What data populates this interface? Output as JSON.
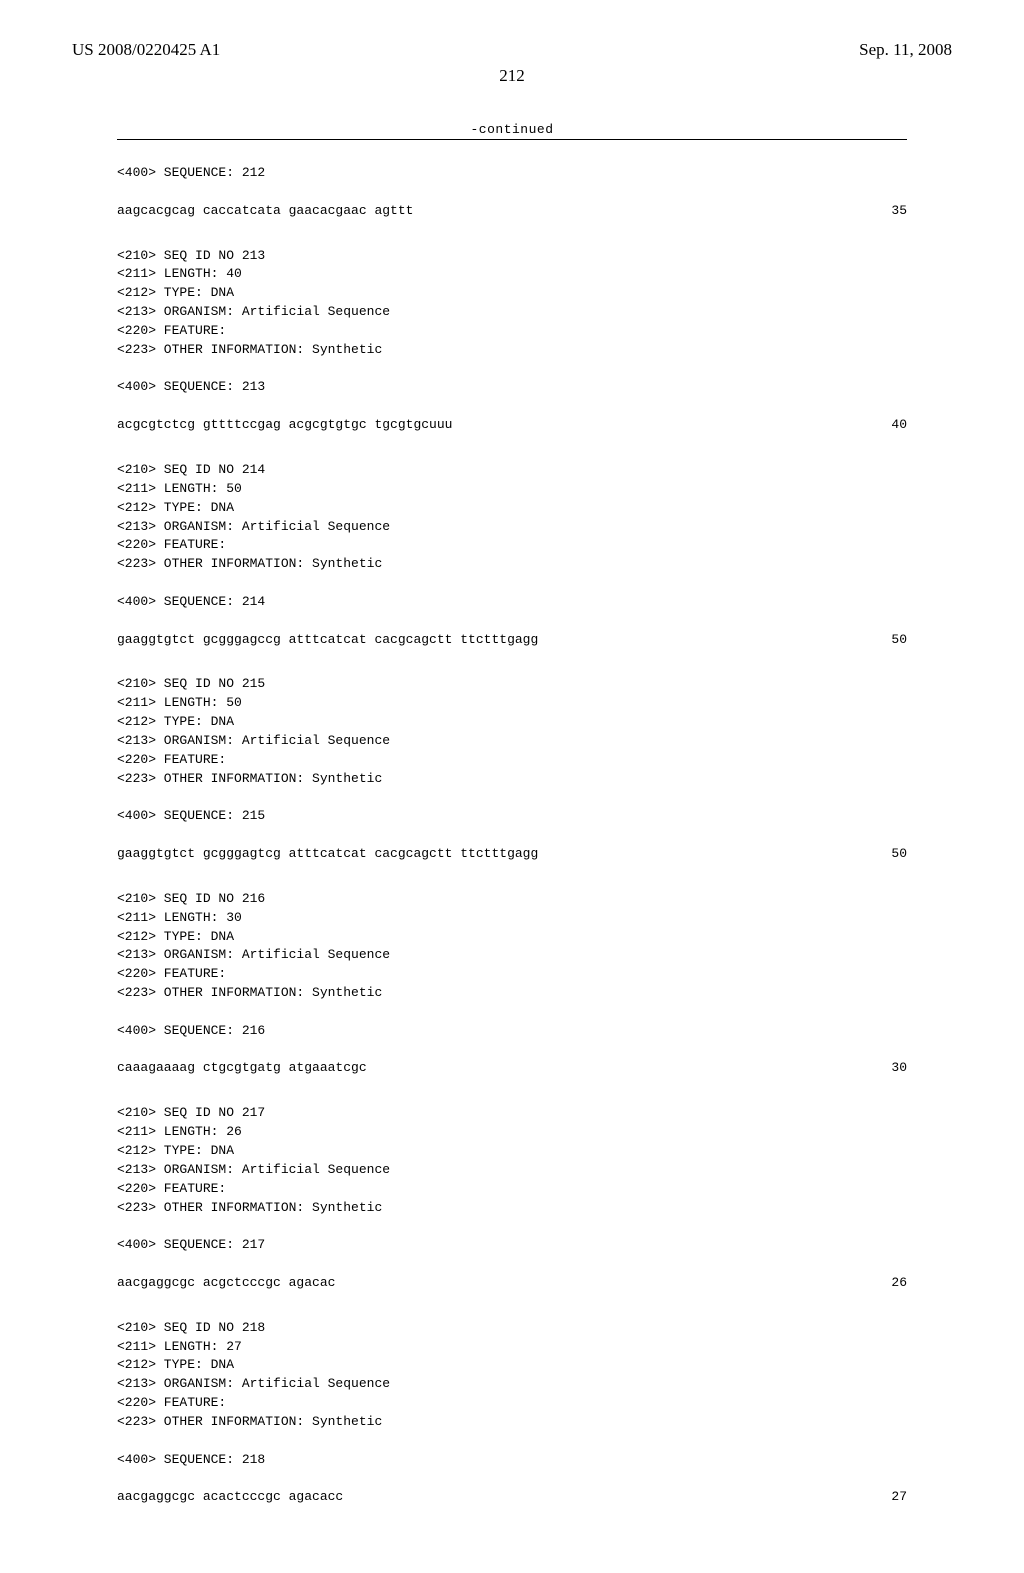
{
  "header": {
    "pub_number": "US 2008/0220425 A1",
    "pub_date": "Sep. 11, 2008"
  },
  "page_number": "212",
  "continued_label": "-continued",
  "entries": [
    {
      "descriptors": [
        "<400> SEQUENCE: 212"
      ],
      "sequence": "aagcacgcag caccatcata gaacacgaac agttt",
      "length": "35"
    },
    {
      "descriptors": [
        "<210> SEQ ID NO 213",
        "<211> LENGTH: 40",
        "<212> TYPE: DNA",
        "<213> ORGANISM: Artificial Sequence",
        "<220> FEATURE:",
        "<223> OTHER INFORMATION: Synthetic",
        "",
        "<400> SEQUENCE: 213"
      ],
      "sequence": "acgcgtctcg gttttccgag acgcgtgtgc tgcgtgcuuu",
      "length": "40"
    },
    {
      "descriptors": [
        "<210> SEQ ID NO 214",
        "<211> LENGTH: 50",
        "<212> TYPE: DNA",
        "<213> ORGANISM: Artificial Sequence",
        "<220> FEATURE:",
        "<223> OTHER INFORMATION: Synthetic",
        "",
        "<400> SEQUENCE: 214"
      ],
      "sequence": "gaaggtgtct gcgggagccg atttcatcat cacgcagctt ttctttgagg",
      "length": "50"
    },
    {
      "descriptors": [
        "<210> SEQ ID NO 215",
        "<211> LENGTH: 50",
        "<212> TYPE: DNA",
        "<213> ORGANISM: Artificial Sequence",
        "<220> FEATURE:",
        "<223> OTHER INFORMATION: Synthetic",
        "",
        "<400> SEQUENCE: 215"
      ],
      "sequence": "gaaggtgtct gcgggagtcg atttcatcat cacgcagctt ttctttgagg",
      "length": "50"
    },
    {
      "descriptors": [
        "<210> SEQ ID NO 216",
        "<211> LENGTH: 30",
        "<212> TYPE: DNA",
        "<213> ORGANISM: Artificial Sequence",
        "<220> FEATURE:",
        "<223> OTHER INFORMATION: Synthetic",
        "",
        "<400> SEQUENCE: 216"
      ],
      "sequence": "caaagaaaag ctgcgtgatg atgaaatcgc",
      "length": "30"
    },
    {
      "descriptors": [
        "<210> SEQ ID NO 217",
        "<211> LENGTH: 26",
        "<212> TYPE: DNA",
        "<213> ORGANISM: Artificial Sequence",
        "<220> FEATURE:",
        "<223> OTHER INFORMATION: Synthetic",
        "",
        "<400> SEQUENCE: 217"
      ],
      "sequence": "aacgaggcgc acgctcccgc agacac",
      "length": "26"
    },
    {
      "descriptors": [
        "<210> SEQ ID NO 218",
        "<211> LENGTH: 27",
        "<212> TYPE: DNA",
        "<213> ORGANISM: Artificial Sequence",
        "<220> FEATURE:",
        "<223> OTHER INFORMATION: Synthetic",
        "",
        "<400> SEQUENCE: 218"
      ],
      "sequence": "aacgaggcgc acactcccgc agacacc",
      "length": "27"
    }
  ]
}
